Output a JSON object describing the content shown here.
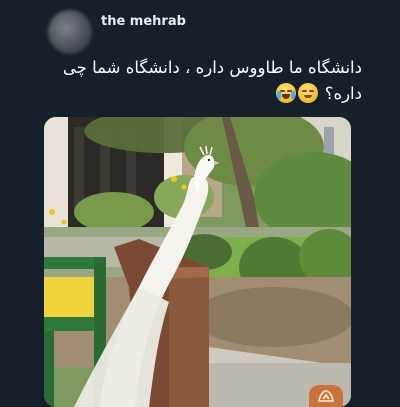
{
  "tweet": {
    "username": "the mehrab",
    "text": "دانشگاه ما طاووس داره ، دانشگاه شما چی داره؟",
    "emojis": [
      "crying-laughing-emoji",
      "pensive-face-emoji"
    ]
  },
  "photo": {
    "icon": "white-peacock-photo",
    "watermark_icon": "watermark-logo-icon"
  },
  "colors": {
    "background": "#15202b",
    "text": "#ffffff",
    "watermark": "#c8733c"
  }
}
